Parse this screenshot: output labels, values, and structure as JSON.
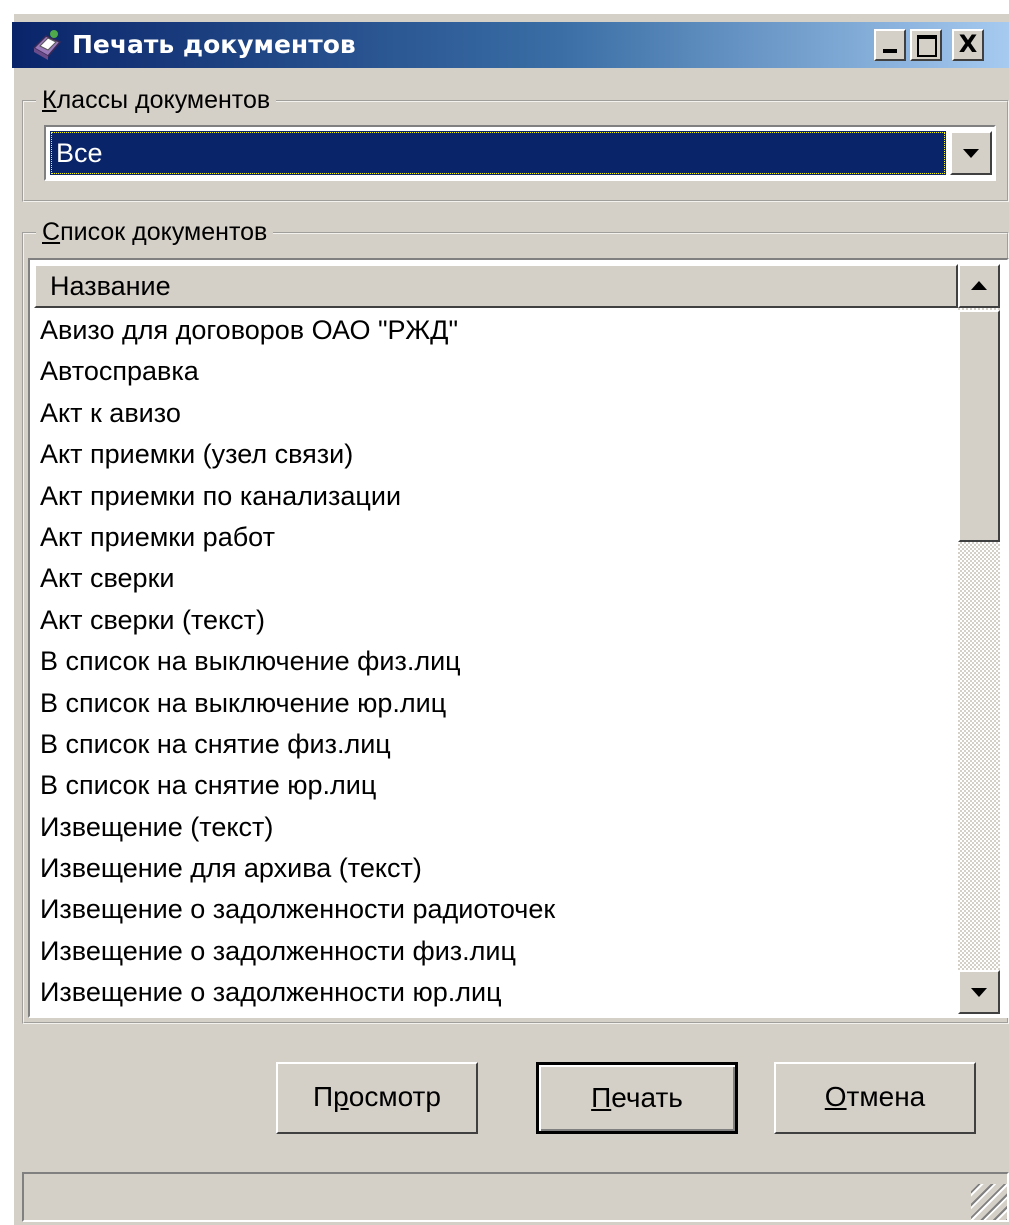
{
  "window": {
    "title": "Печать документов",
    "controls": {
      "minimize": "_",
      "maximize": "□",
      "close": "X"
    }
  },
  "icons": {
    "app": "printer-document-icon",
    "combo_arrow": "chevron-down-icon",
    "scroll_up": "arrow-up-icon",
    "scroll_down": "arrow-down-icon",
    "resize_grip": "size-grip-icon"
  },
  "classes_group": {
    "legend_mnemonic": "К",
    "legend_rest": "лассы документов",
    "selected_value": "Все"
  },
  "documents_group": {
    "legend_mnemonic": "С",
    "legend_rest": "писок документов",
    "column_header": "Название",
    "items": [
      "Авизо для договоров ОАО \"РЖД\"",
      "Автосправка",
      "Акт к авизо",
      "Акт приемки (узел связи)",
      "Акт приемки по канализации",
      "Акт приемки работ",
      "Акт сверки",
      "Акт сверки (текст)",
      "В список на выключение физ.лиц",
      "В список на выключение юр.лиц",
      "В список на снятие физ.лиц",
      "В список на снятие юр.лиц",
      "Извещение (текст)",
      "Извещение для архива (текст)",
      "Извещение о задолженности радиоточек",
      "Извещение о задолженности физ.лиц",
      "Извещение о задолженности юр.лиц"
    ]
  },
  "buttons": {
    "preview": {
      "pre": "П",
      "mnemonic": "р",
      "post": "осмотр"
    },
    "print": {
      "pre": "",
      "mnemonic": "П",
      "post": "ечать"
    },
    "cancel": {
      "pre": "",
      "mnemonic": "О",
      "post": "тмена"
    }
  },
  "colors": {
    "face": "#d4d0c8",
    "selection": "#0a246a",
    "title_gradient_start": "#0a246a",
    "title_gradient_end": "#a6caf0"
  }
}
